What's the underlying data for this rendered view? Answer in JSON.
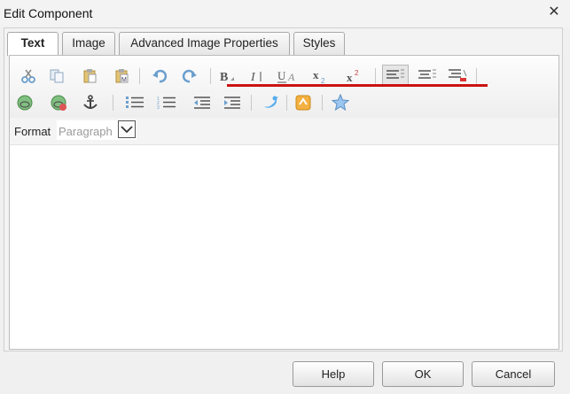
{
  "dialog": {
    "title": "Edit Component",
    "close_symbol": "✕"
  },
  "tabs": [
    {
      "label": "Text",
      "active": true
    },
    {
      "label": "Image",
      "active": false
    },
    {
      "label": "Advanced Image Properties",
      "active": false
    },
    {
      "label": "Styles",
      "active": false
    }
  ],
  "toolbar": {
    "row1": [
      "cut-icon",
      "copy-icon",
      "paste-icon",
      "paste-as-text-icon",
      "paste-from-word-icon",
      "undo-icon",
      "redo-icon",
      "bold-icon",
      "italic-icon",
      "underline-icon",
      "subscript-icon",
      "superscript-icon",
      "justify-left-icon",
      "justify-center-icon",
      "justify-right-icon"
    ],
    "row2": [
      "link-icon",
      "unlink-icon",
      "anchor-icon",
      "bulleted-list-icon",
      "numbered-list-icon",
      "outdent-icon",
      "indent-icon",
      "twitter-icon",
      "source-edit-icon",
      "special-char-icon"
    ],
    "annotation_color": "#cc1111"
  },
  "format": {
    "label": "Format",
    "value": "Paragraph"
  },
  "buttons": {
    "help": "Help",
    "ok": "OK",
    "cancel": "Cancel"
  }
}
